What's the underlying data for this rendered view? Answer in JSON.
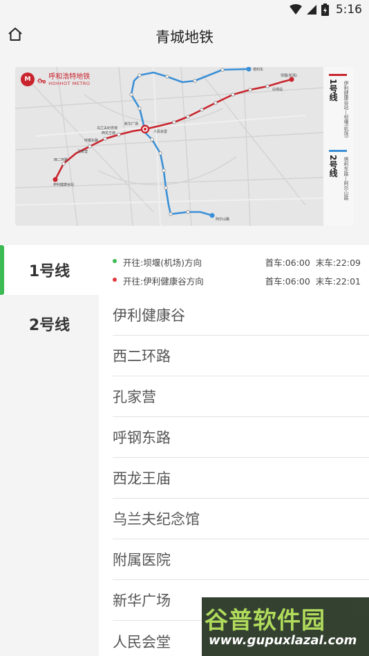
{
  "status_bar": {
    "time": "5:16",
    "icons": [
      "wifi-icon",
      "signal-icon",
      "battery-icon"
    ]
  },
  "app_bar": {
    "title": "青城地铁",
    "home_icon": "home-icon"
  },
  "map": {
    "brand_cn": "呼和浩特地铁",
    "brand_en": "HOHHOT METRO",
    "legend": [
      {
        "line": "1号线",
        "color": "#c9242d",
        "terminals": "伊利健康谷站—坝堰(机场)"
      },
      {
        "line": "2号线",
        "color": "#3a8fd6",
        "terminals": "塔利东路—阿尔山路"
      }
    ],
    "labels": {
      "yili": "伊利健康谷站",
      "bayan": "坝堰(机场)",
      "talidong": "塔利东",
      "aershan": "阿尔山路",
      "xinhua": "新华广场",
      "renmin": "人民会堂",
      "xier": "西二环路",
      "kongjia": "孔家营",
      "hugang": "呼钢东路",
      "xilong": "西龙王庙",
      "wulanfu": "乌兰夫纪念馆",
      "baita": "白塔站"
    }
  },
  "tabs": [
    {
      "label": "1号线",
      "active": true
    },
    {
      "label": "2号线",
      "active": false
    }
  ],
  "schedule": [
    {
      "direction": "开往:坝堰(机场)方向",
      "time": "首车:06:00  末车:22:09",
      "color": "#3dba54"
    },
    {
      "direction": "开往:伊利健康谷方向",
      "time": "首车:06:00  末车:22:01",
      "color": "#e0393e"
    }
  ],
  "stations": [
    "伊利健康谷",
    "西二环路",
    "孔家营",
    "呼钢东路",
    "西龙王庙",
    "乌兰夫纪念馆",
    "附属医院",
    "新华广场",
    "人民会堂"
  ],
  "watermark": {
    "text": "谷普软件园",
    "url": "www.gupuxlazal.com"
  }
}
